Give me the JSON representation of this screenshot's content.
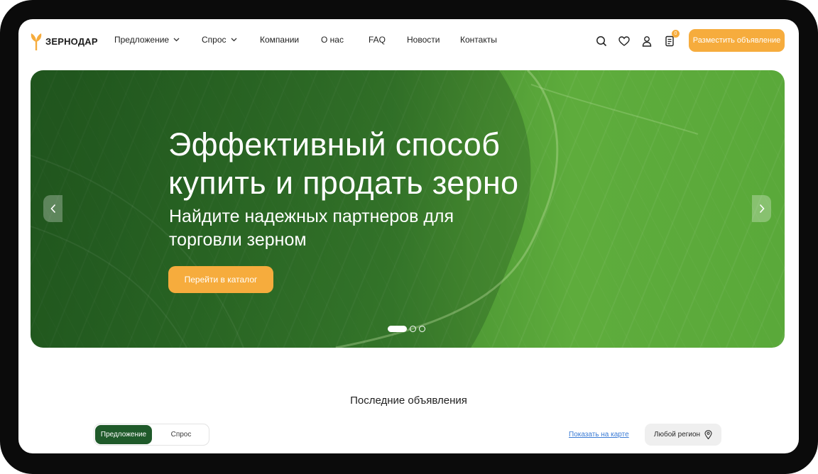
{
  "header": {
    "logo_text": "ЗЕРНОДАР",
    "nav": [
      {
        "label": "Предложение",
        "has_dropdown": true
      },
      {
        "label": "Спрос",
        "has_dropdown": true
      },
      {
        "label": "Компании",
        "has_dropdown": false
      },
      {
        "label": "О нас",
        "has_dropdown": false
      },
      {
        "label": "FAQ",
        "has_dropdown": false
      },
      {
        "label": "Новости",
        "has_dropdown": false
      },
      {
        "label": "Контакты",
        "has_dropdown": false
      }
    ],
    "icons": [
      "search-icon",
      "heart-icon",
      "user-icon",
      "cart-icon"
    ],
    "cart_badge": "0",
    "cta_label": "Разместить объявление"
  },
  "hero": {
    "title_line1": "Эффективный способ",
    "title_line2": "купить и продать зерно",
    "subtitle_line1": "Найдите надежных партнеров для",
    "subtitle_line2": "торговли зерном",
    "button_label": "Перейти в каталог",
    "slides_total": 3,
    "active_slide": 1
  },
  "listings": {
    "title": "Последние объявления",
    "toggle": {
      "active": "Предложение",
      "inactive": "Спрос"
    },
    "map_link": "Показать на карте",
    "region_label": "Любой регион"
  },
  "colors": {
    "accent": "#f6ac3d",
    "dark_green": "#1f5a2a",
    "link_blue": "#3a7bd5",
    "frame": "#0b0b0b"
  }
}
